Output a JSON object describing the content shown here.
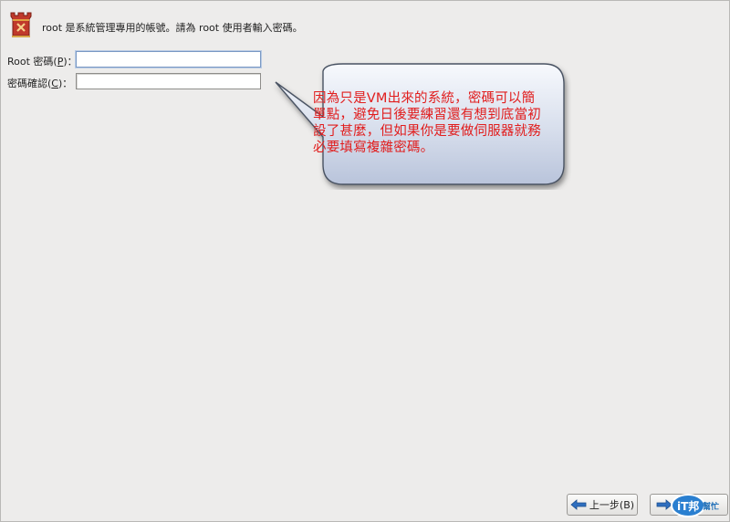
{
  "header": {
    "icon": "castle-tower-icon",
    "text": "root 是系統管理專用的帳號。請為 root 使用者輸入密碼。"
  },
  "form": {
    "password": {
      "label_prefix": "Root 密碼(",
      "mnemonic": "P",
      "label_suffix": ")：",
      "value": ""
    },
    "confirm": {
      "label_prefix": "密碼確認(",
      "mnemonic": "C",
      "label_suffix": ")：",
      "value": ""
    }
  },
  "callout": {
    "text": "因為只是VM出來的系統，密碼可以簡單點，避免日後要練習還有想到底當初設了甚麼，但如果你是要做伺服器就務必要填寫複雜密碼。",
    "text_color": "#e11d1d",
    "bubble_color": "#c9d3e6"
  },
  "nav": {
    "back_label": "上一步(B)",
    "back_icon": "arrow-left-icon",
    "next_icon": "arrow-right-icon"
  },
  "watermark": {
    "logo_text": "iT邦",
    "label": "幫忙"
  }
}
